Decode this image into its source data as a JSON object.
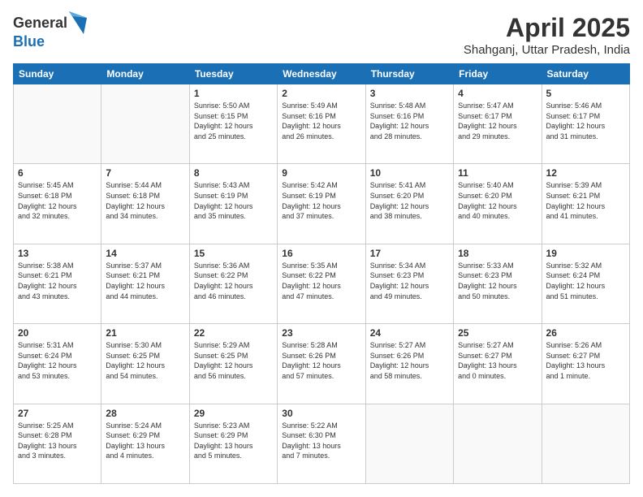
{
  "header": {
    "logo_general": "General",
    "logo_blue": "Blue",
    "title": "April 2025",
    "subtitle": "Shahganj, Uttar Pradesh, India"
  },
  "weekdays": [
    "Sunday",
    "Monday",
    "Tuesday",
    "Wednesday",
    "Thursday",
    "Friday",
    "Saturday"
  ],
  "weeks": [
    [
      {
        "day": "",
        "info": ""
      },
      {
        "day": "",
        "info": ""
      },
      {
        "day": "1",
        "info": "Sunrise: 5:50 AM\nSunset: 6:15 PM\nDaylight: 12 hours\nand 25 minutes."
      },
      {
        "day": "2",
        "info": "Sunrise: 5:49 AM\nSunset: 6:16 PM\nDaylight: 12 hours\nand 26 minutes."
      },
      {
        "day": "3",
        "info": "Sunrise: 5:48 AM\nSunset: 6:16 PM\nDaylight: 12 hours\nand 28 minutes."
      },
      {
        "day": "4",
        "info": "Sunrise: 5:47 AM\nSunset: 6:17 PM\nDaylight: 12 hours\nand 29 minutes."
      },
      {
        "day": "5",
        "info": "Sunrise: 5:46 AM\nSunset: 6:17 PM\nDaylight: 12 hours\nand 31 minutes."
      }
    ],
    [
      {
        "day": "6",
        "info": "Sunrise: 5:45 AM\nSunset: 6:18 PM\nDaylight: 12 hours\nand 32 minutes."
      },
      {
        "day": "7",
        "info": "Sunrise: 5:44 AM\nSunset: 6:18 PM\nDaylight: 12 hours\nand 34 minutes."
      },
      {
        "day": "8",
        "info": "Sunrise: 5:43 AM\nSunset: 6:19 PM\nDaylight: 12 hours\nand 35 minutes."
      },
      {
        "day": "9",
        "info": "Sunrise: 5:42 AM\nSunset: 6:19 PM\nDaylight: 12 hours\nand 37 minutes."
      },
      {
        "day": "10",
        "info": "Sunrise: 5:41 AM\nSunset: 6:20 PM\nDaylight: 12 hours\nand 38 minutes."
      },
      {
        "day": "11",
        "info": "Sunrise: 5:40 AM\nSunset: 6:20 PM\nDaylight: 12 hours\nand 40 minutes."
      },
      {
        "day": "12",
        "info": "Sunrise: 5:39 AM\nSunset: 6:21 PM\nDaylight: 12 hours\nand 41 minutes."
      }
    ],
    [
      {
        "day": "13",
        "info": "Sunrise: 5:38 AM\nSunset: 6:21 PM\nDaylight: 12 hours\nand 43 minutes."
      },
      {
        "day": "14",
        "info": "Sunrise: 5:37 AM\nSunset: 6:21 PM\nDaylight: 12 hours\nand 44 minutes."
      },
      {
        "day": "15",
        "info": "Sunrise: 5:36 AM\nSunset: 6:22 PM\nDaylight: 12 hours\nand 46 minutes."
      },
      {
        "day": "16",
        "info": "Sunrise: 5:35 AM\nSunset: 6:22 PM\nDaylight: 12 hours\nand 47 minutes."
      },
      {
        "day": "17",
        "info": "Sunrise: 5:34 AM\nSunset: 6:23 PM\nDaylight: 12 hours\nand 49 minutes."
      },
      {
        "day": "18",
        "info": "Sunrise: 5:33 AM\nSunset: 6:23 PM\nDaylight: 12 hours\nand 50 minutes."
      },
      {
        "day": "19",
        "info": "Sunrise: 5:32 AM\nSunset: 6:24 PM\nDaylight: 12 hours\nand 51 minutes."
      }
    ],
    [
      {
        "day": "20",
        "info": "Sunrise: 5:31 AM\nSunset: 6:24 PM\nDaylight: 12 hours\nand 53 minutes."
      },
      {
        "day": "21",
        "info": "Sunrise: 5:30 AM\nSunset: 6:25 PM\nDaylight: 12 hours\nand 54 minutes."
      },
      {
        "day": "22",
        "info": "Sunrise: 5:29 AM\nSunset: 6:25 PM\nDaylight: 12 hours\nand 56 minutes."
      },
      {
        "day": "23",
        "info": "Sunrise: 5:28 AM\nSunset: 6:26 PM\nDaylight: 12 hours\nand 57 minutes."
      },
      {
        "day": "24",
        "info": "Sunrise: 5:27 AM\nSunset: 6:26 PM\nDaylight: 12 hours\nand 58 minutes."
      },
      {
        "day": "25",
        "info": "Sunrise: 5:27 AM\nSunset: 6:27 PM\nDaylight: 13 hours\nand 0 minutes."
      },
      {
        "day": "26",
        "info": "Sunrise: 5:26 AM\nSunset: 6:27 PM\nDaylight: 13 hours\nand 1 minute."
      }
    ],
    [
      {
        "day": "27",
        "info": "Sunrise: 5:25 AM\nSunset: 6:28 PM\nDaylight: 13 hours\nand 3 minutes."
      },
      {
        "day": "28",
        "info": "Sunrise: 5:24 AM\nSunset: 6:29 PM\nDaylight: 13 hours\nand 4 minutes."
      },
      {
        "day": "29",
        "info": "Sunrise: 5:23 AM\nSunset: 6:29 PM\nDaylight: 13 hours\nand 5 minutes."
      },
      {
        "day": "30",
        "info": "Sunrise: 5:22 AM\nSunset: 6:30 PM\nDaylight: 13 hours\nand 7 minutes."
      },
      {
        "day": "",
        "info": ""
      },
      {
        "day": "",
        "info": ""
      },
      {
        "day": "",
        "info": ""
      }
    ]
  ]
}
